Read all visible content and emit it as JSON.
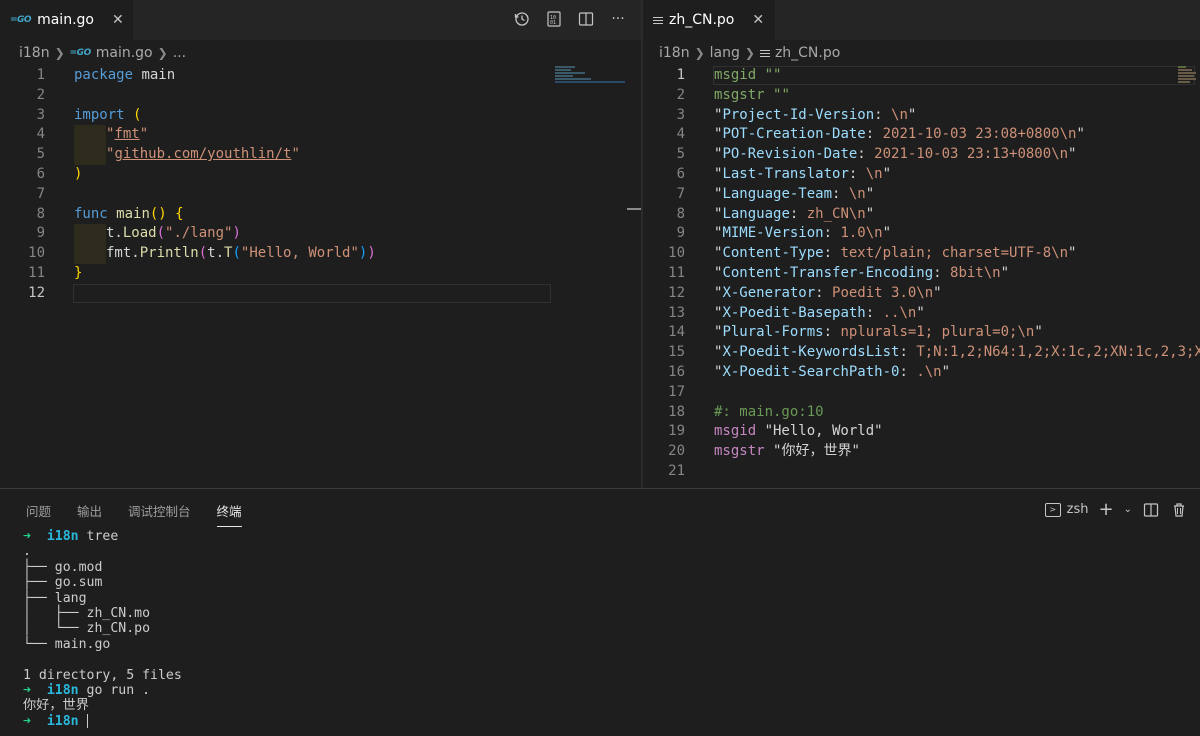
{
  "left_editor": {
    "tab": {
      "icon": "go-file-icon",
      "label": "main.go",
      "close": "✕"
    },
    "breadcrumb": [
      "i18n",
      "main.go",
      "..."
    ],
    "code": [
      {
        "n": "1",
        "parts": [
          {
            "t": "package ",
            "c": "kw"
          },
          {
            "t": "main",
            "c": ""
          }
        ]
      },
      {
        "n": "2",
        "parts": []
      },
      {
        "n": "3",
        "parts": [
          {
            "t": "import ",
            "c": "kw"
          },
          {
            "t": "(",
            "c": "paren-y"
          }
        ]
      },
      {
        "n": "4",
        "indent": 1,
        "parts": [
          {
            "t": "\"",
            "c": "str"
          },
          {
            "t": "fmt",
            "c": "str ul"
          },
          {
            "t": "\"",
            "c": "str"
          }
        ]
      },
      {
        "n": "5",
        "indent": 1,
        "parts": [
          {
            "t": "\"",
            "c": "str"
          },
          {
            "t": "github.com/youthlin/t",
            "c": "str ul"
          },
          {
            "t": "\"",
            "c": "str"
          }
        ]
      },
      {
        "n": "6",
        "parts": [
          {
            "t": ")",
            "c": "paren-y"
          }
        ]
      },
      {
        "n": "7",
        "parts": []
      },
      {
        "n": "8",
        "parts": [
          {
            "t": "func ",
            "c": "kw"
          },
          {
            "t": "main",
            "c": "fn"
          },
          {
            "t": "()",
            "c": "paren-y"
          },
          {
            "t": " ",
            "c": ""
          },
          {
            "t": "{",
            "c": "paren-y"
          }
        ]
      },
      {
        "n": "9",
        "indent": 1,
        "parts": [
          {
            "t": "t.",
            "c": ""
          },
          {
            "t": "Load",
            "c": "fn"
          },
          {
            "t": "(",
            "c": "paren-p"
          },
          {
            "t": "\"./lang\"",
            "c": "str"
          },
          {
            "t": ")",
            "c": "paren-p"
          }
        ]
      },
      {
        "n": "10",
        "indent": 1,
        "parts": [
          {
            "t": "fmt.",
            "c": ""
          },
          {
            "t": "Println",
            "c": "fn"
          },
          {
            "t": "(",
            "c": "paren-p"
          },
          {
            "t": "t.",
            "c": ""
          },
          {
            "t": "T",
            "c": "fn"
          },
          {
            "t": "(",
            "c": "paren-b"
          },
          {
            "t": "\"Hello, World\"",
            "c": "str"
          },
          {
            "t": ")",
            "c": "paren-b"
          },
          {
            "t": ")",
            "c": "paren-p"
          }
        ]
      },
      {
        "n": "11",
        "parts": [
          {
            "t": "}",
            "c": "paren-y"
          }
        ]
      },
      {
        "n": "12",
        "active": true,
        "parts": []
      }
    ]
  },
  "right_editor": {
    "tab": {
      "icon": "po-file-icon",
      "label": "zh_CN.po",
      "close": "✕"
    },
    "breadcrumb": [
      "i18n",
      "lang",
      "zh_CN.po"
    ],
    "code": [
      {
        "n": "1",
        "active": true,
        "parts": [
          {
            "t": "msgid ",
            "c": "po-str"
          },
          {
            "t": "\"\"",
            "c": "po-str"
          }
        ]
      },
      {
        "n": "2",
        "parts": [
          {
            "t": "msgstr ",
            "c": "po-str"
          },
          {
            "t": "\"\"",
            "c": "po-str"
          }
        ]
      },
      {
        "n": "3",
        "parts": [
          {
            "t": "\"",
            "c": ""
          },
          {
            "t": "Project-Id-Version",
            "c": "po-key"
          },
          {
            "t": ": ",
            "c": ""
          },
          {
            "t": "\\n",
            "c": "po-val"
          },
          {
            "t": "\"",
            "c": ""
          }
        ]
      },
      {
        "n": "4",
        "parts": [
          {
            "t": "\"",
            "c": ""
          },
          {
            "t": "POT-Creation-Date",
            "c": "po-key"
          },
          {
            "t": ": ",
            "c": ""
          },
          {
            "t": "2021-10-03 23:08+0800\\n",
            "c": "po-val"
          },
          {
            "t": "\"",
            "c": ""
          }
        ]
      },
      {
        "n": "5",
        "parts": [
          {
            "t": "\"",
            "c": ""
          },
          {
            "t": "PO-Revision-Date",
            "c": "po-key"
          },
          {
            "t": ": ",
            "c": ""
          },
          {
            "t": "2021-10-03 23:13+0800\\n",
            "c": "po-val"
          },
          {
            "t": "\"",
            "c": ""
          }
        ]
      },
      {
        "n": "6",
        "parts": [
          {
            "t": "\"",
            "c": ""
          },
          {
            "t": "Last-Translator",
            "c": "po-key"
          },
          {
            "t": ": ",
            "c": ""
          },
          {
            "t": "\\n",
            "c": "po-val"
          },
          {
            "t": "\"",
            "c": ""
          }
        ]
      },
      {
        "n": "7",
        "parts": [
          {
            "t": "\"",
            "c": ""
          },
          {
            "t": "Language-Team",
            "c": "po-key"
          },
          {
            "t": ": ",
            "c": ""
          },
          {
            "t": "\\n",
            "c": "po-val"
          },
          {
            "t": "\"",
            "c": ""
          }
        ]
      },
      {
        "n": "8",
        "parts": [
          {
            "t": "\"",
            "c": ""
          },
          {
            "t": "Language",
            "c": "po-key"
          },
          {
            "t": ": ",
            "c": ""
          },
          {
            "t": "zh_CN\\n",
            "c": "po-val"
          },
          {
            "t": "\"",
            "c": ""
          }
        ]
      },
      {
        "n": "9",
        "parts": [
          {
            "t": "\"",
            "c": ""
          },
          {
            "t": "MIME-Version",
            "c": "po-key"
          },
          {
            "t": ": ",
            "c": ""
          },
          {
            "t": "1.0\\n",
            "c": "po-val"
          },
          {
            "t": "\"",
            "c": ""
          }
        ]
      },
      {
        "n": "10",
        "parts": [
          {
            "t": "\"",
            "c": ""
          },
          {
            "t": "Content-Type",
            "c": "po-key"
          },
          {
            "t": ": ",
            "c": ""
          },
          {
            "t": "text/plain; charset=UTF-8\\n",
            "c": "po-val"
          },
          {
            "t": "\"",
            "c": ""
          }
        ]
      },
      {
        "n": "11",
        "parts": [
          {
            "t": "\"",
            "c": ""
          },
          {
            "t": "Content-Transfer-Encoding",
            "c": "po-key"
          },
          {
            "t": ": ",
            "c": ""
          },
          {
            "t": "8bit\\n",
            "c": "po-val"
          },
          {
            "t": "\"",
            "c": ""
          }
        ]
      },
      {
        "n": "12",
        "parts": [
          {
            "t": "\"",
            "c": ""
          },
          {
            "t": "X-Generator",
            "c": "po-key"
          },
          {
            "t": ": ",
            "c": ""
          },
          {
            "t": "Poedit 3.0\\n",
            "c": "po-val"
          },
          {
            "t": "\"",
            "c": ""
          }
        ]
      },
      {
        "n": "13",
        "parts": [
          {
            "t": "\"",
            "c": ""
          },
          {
            "t": "X-Poedit-Basepath",
            "c": "po-key"
          },
          {
            "t": ": ",
            "c": ""
          },
          {
            "t": "..\\n",
            "c": "po-val"
          },
          {
            "t": "\"",
            "c": ""
          }
        ]
      },
      {
        "n": "14",
        "parts": [
          {
            "t": "\"",
            "c": ""
          },
          {
            "t": "Plural-Forms",
            "c": "po-key"
          },
          {
            "t": ": ",
            "c": ""
          },
          {
            "t": "nplurals=1; plural=0;\\n",
            "c": "po-val"
          },
          {
            "t": "\"",
            "c": ""
          }
        ]
      },
      {
        "n": "15",
        "parts": [
          {
            "t": "\"",
            "c": ""
          },
          {
            "t": "X-Poedit-KeywordsList",
            "c": "po-key"
          },
          {
            "t": ": ",
            "c": ""
          },
          {
            "t": "T;N:1,2;N64:1,2;X:1c,2;XN:1c,2,3;X",
            "c": "po-val"
          }
        ]
      },
      {
        "n": "16",
        "parts": [
          {
            "t": "\"",
            "c": ""
          },
          {
            "t": "X-Poedit-SearchPath-0",
            "c": "po-key"
          },
          {
            "t": ": ",
            "c": ""
          },
          {
            "t": ".\\n",
            "c": "po-val"
          },
          {
            "t": "\"",
            "c": ""
          }
        ]
      },
      {
        "n": "17",
        "parts": []
      },
      {
        "n": "18",
        "parts": [
          {
            "t": "#: main.go:10",
            "c": "po-cm"
          }
        ]
      },
      {
        "n": "19",
        "parts": [
          {
            "t": "msgid ",
            "c": "po-kw"
          },
          {
            "t": "\"Hello, World\"",
            "c": ""
          }
        ]
      },
      {
        "n": "20",
        "parts": [
          {
            "t": "msgstr ",
            "c": "po-kw"
          },
          {
            "t": "\"你好，世界\"",
            "c": ""
          }
        ]
      },
      {
        "n": "21",
        "parts": []
      }
    ]
  },
  "panel": {
    "tabs": [
      "问题",
      "输出",
      "调试控制台",
      "终端"
    ],
    "active_tab": "终端",
    "shell": "zsh",
    "terminal": [
      [
        {
          "t": "➜  ",
          "c": "prompt-arrow"
        },
        {
          "t": "i18n",
          "c": "prompt-dir"
        },
        {
          "t": " tree",
          "c": ""
        }
      ],
      [
        {
          "t": ".",
          "c": ""
        }
      ],
      [
        {
          "t": "├── go.mod",
          "c": ""
        }
      ],
      [
        {
          "t": "├── go.sum",
          "c": ""
        }
      ],
      [
        {
          "t": "├── lang",
          "c": ""
        }
      ],
      [
        {
          "t": "│   ├── zh_CN.mo",
          "c": ""
        }
      ],
      [
        {
          "t": "│   └── zh_CN.po",
          "c": ""
        }
      ],
      [
        {
          "t": "└── main.go",
          "c": ""
        }
      ],
      [],
      [
        {
          "t": "1 directory, 5 files",
          "c": ""
        }
      ],
      [
        {
          "t": "➜  ",
          "c": "prompt-arrow"
        },
        {
          "t": "i18n",
          "c": "prompt-dir"
        },
        {
          "t": " go run .",
          "c": ""
        }
      ],
      [
        {
          "t": "你好，世界",
          "c": ""
        }
      ],
      [
        {
          "t": "➜  ",
          "c": "prompt-arrow"
        },
        {
          "t": "i18n",
          "c": "prompt-dir"
        },
        {
          "t": " ",
          "c": ""
        },
        {
          "t": "",
          "c": "caret"
        }
      ]
    ]
  }
}
